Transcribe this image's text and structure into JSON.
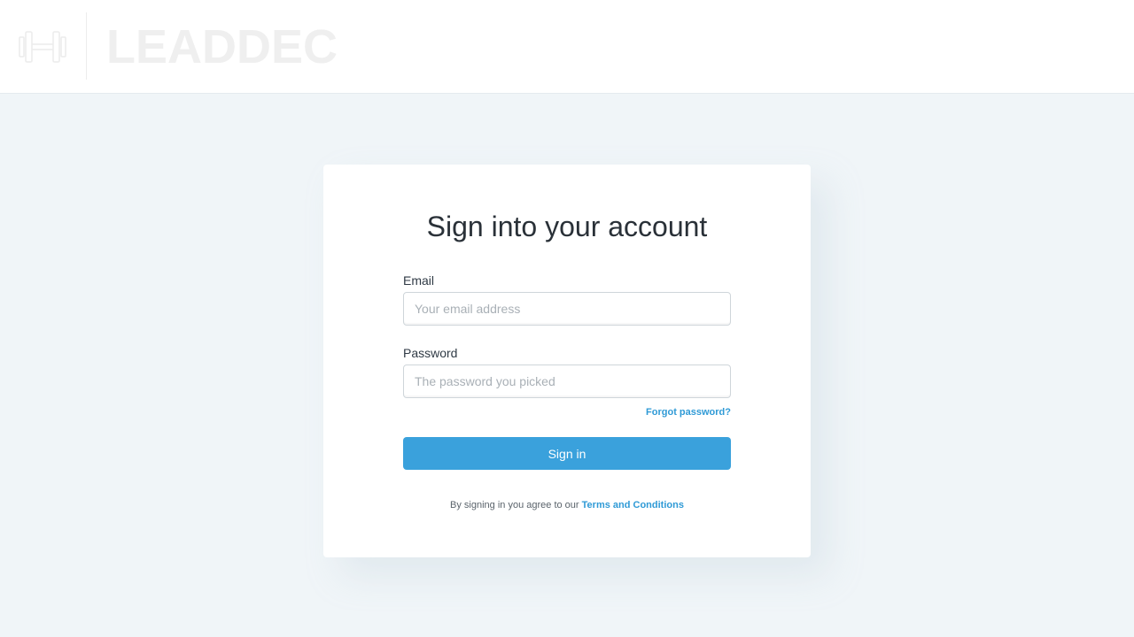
{
  "header": {
    "logo_text": "LEADDEC",
    "logo_icon": "dumbbell-icon"
  },
  "login": {
    "title": "Sign into your account",
    "email_label": "Email",
    "email_placeholder": "Your email address",
    "email_value": "",
    "password_label": "Password",
    "password_placeholder": "The password you picked",
    "password_value": "",
    "forgot_label": "Forgot password?",
    "signin_label": "Sign in",
    "terms_prefix": "By signing in you agree to our",
    "terms_link": "Terms and Conditions"
  },
  "colors": {
    "accent": "#3aa1dc",
    "link": "#2f9ad6",
    "background": "#f0f5f8"
  }
}
